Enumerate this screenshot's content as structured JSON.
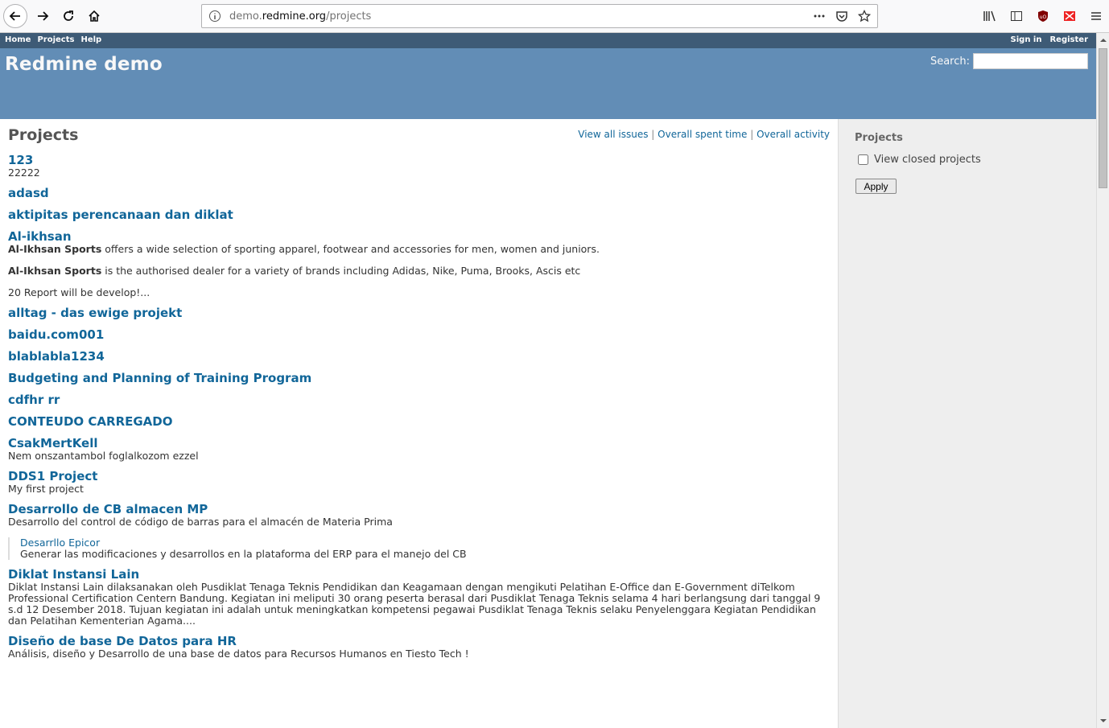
{
  "browser": {
    "url_prefix": "demo.",
    "url_domain": "redmine.org",
    "url_path": "/projects"
  },
  "top_menu": {
    "left": [
      "Home",
      "Projects",
      "Help"
    ],
    "right": [
      "Sign in",
      "Register"
    ]
  },
  "header": {
    "title": "Redmine demo",
    "search_label": "Search:"
  },
  "main": {
    "title": "Projects",
    "links": [
      "View all issues",
      "Overall spent time",
      "Overall activity"
    ],
    "separator": "|"
  },
  "projects": [
    {
      "name": "123",
      "desc": [
        "22222"
      ]
    },
    {
      "name": "adasd",
      "desc": []
    },
    {
      "name": "aktipitas perencanaan dan diklat",
      "desc": []
    },
    {
      "name": "Al-ikhsan",
      "desc_rich": true
    },
    {
      "name": "alltag - das ewige projekt",
      "desc": []
    },
    {
      "name": "baidu.com001",
      "desc": []
    },
    {
      "name": "blablabla1234",
      "desc": []
    },
    {
      "name": "Budgeting and Planning of Training Program",
      "desc": []
    },
    {
      "name": "cdfhr rr",
      "desc": []
    },
    {
      "name": "CONTEUDO CARREGADO",
      "desc": []
    },
    {
      "name": "CsakMertKell",
      "desc": [
        "Nem onszantambol foglalkozom ezzel"
      ]
    },
    {
      "name": "DDS1 Project",
      "desc": [
        "My first project"
      ]
    },
    {
      "name": "Desarrollo de CB almacen MP",
      "desc": [
        "Desarrollo del control de código de barras para el almacén de Materia Prima"
      ]
    },
    {
      "name": "Diklat Instansi Lain",
      "desc": [
        "Diklat Instansi Lain dilaksanakan oleh Pusdiklat Tenaga Teknis Pendidikan dan Keagamaan dengan mengikuti Pelatihan E-Office dan E-Government diTelkom Professional Certification Centern Bandung. Kegiatan ini meliputi 30 orang peserta berasal dari Pusdiklat Tenaga Teknis selama 4 hari berlangsung dari tanggal 9 s.d 12 Desember 2018. Tujuan kegiatan ini adalah untuk meningkatkan kompetensi pegawai Pusdiklat Tenaga Teknis selaku Penyelenggara Kegiatan Pendidikan dan Pelatihan Kementerian Agama...."
      ]
    },
    {
      "name": "Diseño de base De Datos para HR",
      "desc": [
        "Análisis, diseño y Desarrollo de una base de datos para Recursos Humanos en Tiesto Tech !"
      ]
    }
  ],
  "al_ikhsan": {
    "p1_bold": "Al-Ikhsan Sports",
    "p1_rest": " offers a wide selection of sporting apparel, footwear and accessories for men, women and juniors.",
    "p2_bold": "Al-Ikhsan Sports",
    "p2_rest": " is the authorised dealer for a variety of brands including Adidas, Nike, Puma, Brooks, Ascis etc",
    "p3": "20 Report will be develop!..."
  },
  "subproject": {
    "name": "Desarrllo Epicor",
    "desc": "Generar las modificaciones y desarrollos en la plataforma del ERP para el manejo del CB"
  },
  "sidebar": {
    "title": "Projects",
    "checkbox_label": "View closed projects",
    "apply_label": "Apply"
  },
  "colors": {
    "top_menu": "#3e5b76",
    "header": "#628db6",
    "link": "#169",
    "sidebar": "#eeeeee"
  }
}
